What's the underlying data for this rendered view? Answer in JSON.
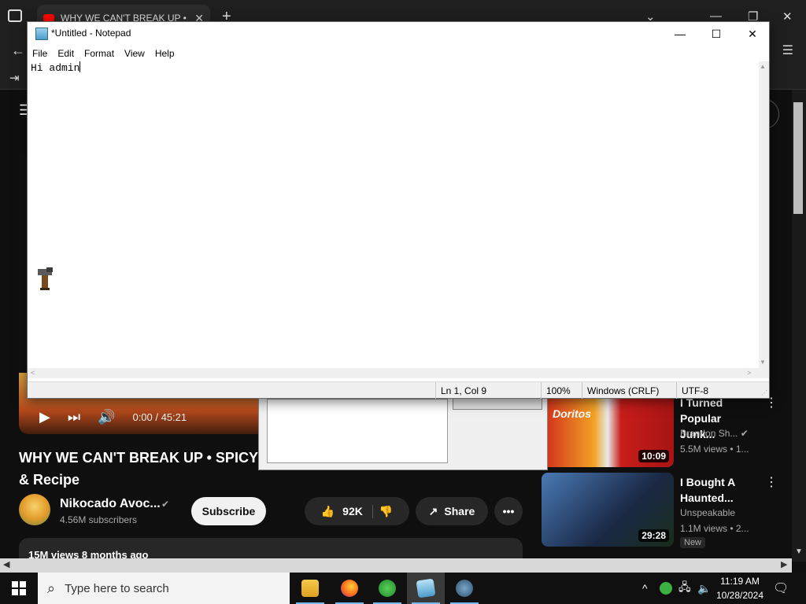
{
  "browser": {
    "tab_title": "WHY WE CAN'T BREAK UP • SPICY",
    "tab_close": "✕",
    "new_tab": "+",
    "window_controls": {
      "minimize": "—",
      "restore": "❐",
      "close": "✕",
      "tab_list": "⌄"
    },
    "back": "←",
    "login": "⇥",
    "menu": "☰"
  },
  "youtube": {
    "menu": "☰",
    "video": {
      "play": "▶",
      "next": "⏭",
      "volume": "🔊",
      "time": "0:00 / 45:21",
      "title": "WHY WE CAN'T BREAK UP • SPICY & Recipe"
    },
    "channel": {
      "name": "Nikocado Avoc...",
      "verified": "✔",
      "subscribers": "4.56M subscribers",
      "subscribe_label": "Subscribe"
    },
    "actions": {
      "like_count": "92K",
      "like_icon": "👍",
      "dislike_icon": "👎",
      "share_label": "Share",
      "share_icon": "↗",
      "more": "•••"
    },
    "description": {
      "text": "15M views  8 months ago"
    },
    "recommendations": [
      {
        "title": "I Turned Popular Junk...",
        "channel": "Brandon Sh...",
        "verified": "✔",
        "views": "5.5M views • 1...",
        "duration": "10:09",
        "thumb_text": "Doritos",
        "more": "⋮",
        "badge": ""
      },
      {
        "title": "I Bought A Haunted...",
        "channel": "Unspeakable",
        "verified": "",
        "views": "1.1M views • 2...",
        "duration": "29:28",
        "thumb_text": "",
        "more": "⋮",
        "badge": "New"
      }
    ]
  },
  "notepad": {
    "title": "*Untitled - Notepad",
    "controls": {
      "minimize": "—",
      "maximize": "☐",
      "close": "✕"
    },
    "menus": [
      "File",
      "Edit",
      "Format",
      "View",
      "Help"
    ],
    "content": "Hi admin",
    "status": {
      "position": "Ln 1, Col 9",
      "zoom": "100%",
      "line_endings": "Windows (CRLF)",
      "encoding": "UTF-8"
    }
  },
  "taskbar": {
    "search_placeholder": "Type here to search",
    "time": "11:19 AM",
    "date": "10/28/2024",
    "tray_arrow": "^",
    "apps": [
      "file-explorer",
      "firefox",
      "people",
      "notepad",
      "network"
    ]
  },
  "colors": {
    "youtube_bg": "#0f0f0f",
    "notepad_bg": "#ffffff",
    "taskbar_bg": "#101010",
    "accent": "#76b9ed",
    "youtube_red": "#ff0000"
  }
}
